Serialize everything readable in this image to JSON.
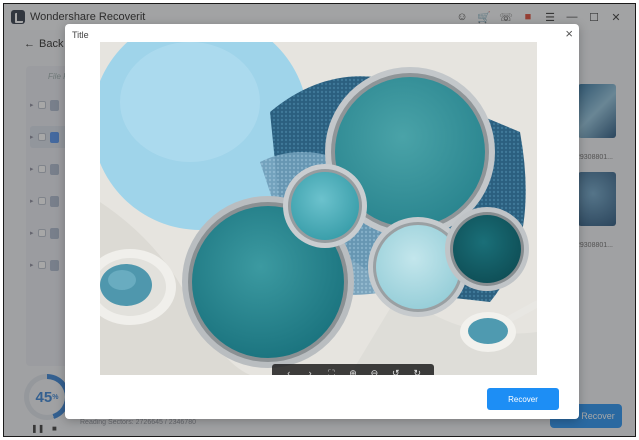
{
  "app": {
    "title": "Wondershare Recoverit"
  },
  "titlebar_icons": [
    "user-icon",
    "cart-icon",
    "headset-icon",
    "gift-icon",
    "menu-icon",
    "minimize-icon",
    "maximize-icon",
    "close-icon"
  ],
  "nav": {
    "back_label": "Back"
  },
  "sidebar": {
    "header": "File Pa",
    "rows": 6,
    "selected_index": 1
  },
  "thumbnails": [
    {
      "label": "29308801..."
    },
    {
      "label": "29308801..."
    }
  ],
  "scan": {
    "progress_percent": 45,
    "progress_value": "45",
    "progress_unit": "%",
    "status": "Reading Sectors: 2726645 / 2346780"
  },
  "background_recover_label": "Recover",
  "modal": {
    "title": "Title",
    "close_glyph": "×",
    "recover_label": "Recover",
    "toolbar": [
      {
        "name": "prev-icon",
        "glyph": "‹"
      },
      {
        "name": "next-icon",
        "glyph": "›"
      },
      {
        "name": "fullscreen-icon",
        "glyph": "⛶"
      },
      {
        "name": "zoom-in-icon",
        "glyph": "⊕"
      },
      {
        "name": "zoom-out-icon",
        "glyph": "⊖"
      },
      {
        "name": "rotate-left-icon",
        "glyph": "↺"
      },
      {
        "name": "rotate-right-icon",
        "glyph": "↻"
      }
    ]
  },
  "colors": {
    "accent": "#1d8ef5",
    "progress": "#2f7fd6",
    "teal_dark": "#19707f",
    "teal_mid": "#2b8c96",
    "light_blue": "#9fd4ea"
  }
}
